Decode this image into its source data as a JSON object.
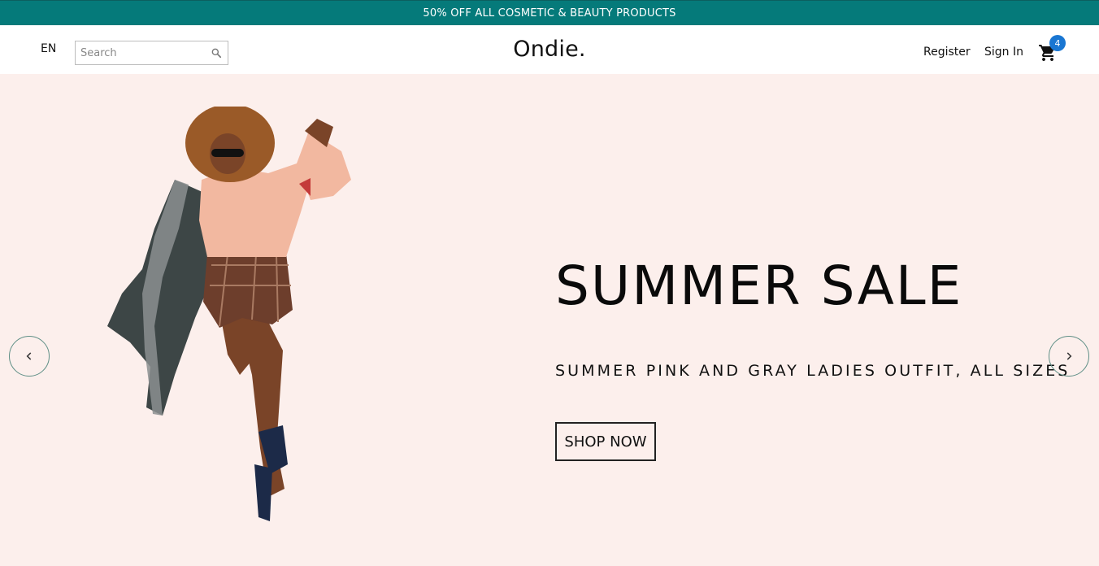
{
  "announcement": {
    "text": "50% OFF ALL COSMETIC & BEAUTY PRODUCTS",
    "bg_color": "#057a7a"
  },
  "navbar": {
    "language": "EN",
    "search": {
      "placeholder": "Search",
      "value": "",
      "icon": "search-icon"
    },
    "logo": "Ondie.",
    "register_label": "Register",
    "signin_label": "Sign In",
    "cart": {
      "icon": "cart-icon",
      "count": "4",
      "badge_color": "#1976d2"
    }
  },
  "hero": {
    "bg_color": "#fcefec",
    "title": "SUMMER SALE",
    "subtitle": "SUMMER PINK AND GRAY LADIES OUTFIT, ALL SIZES",
    "button_label": "SHOP NOW",
    "prev_icon": "chevron-left-icon",
    "next_icon": "chevron-right-icon"
  }
}
